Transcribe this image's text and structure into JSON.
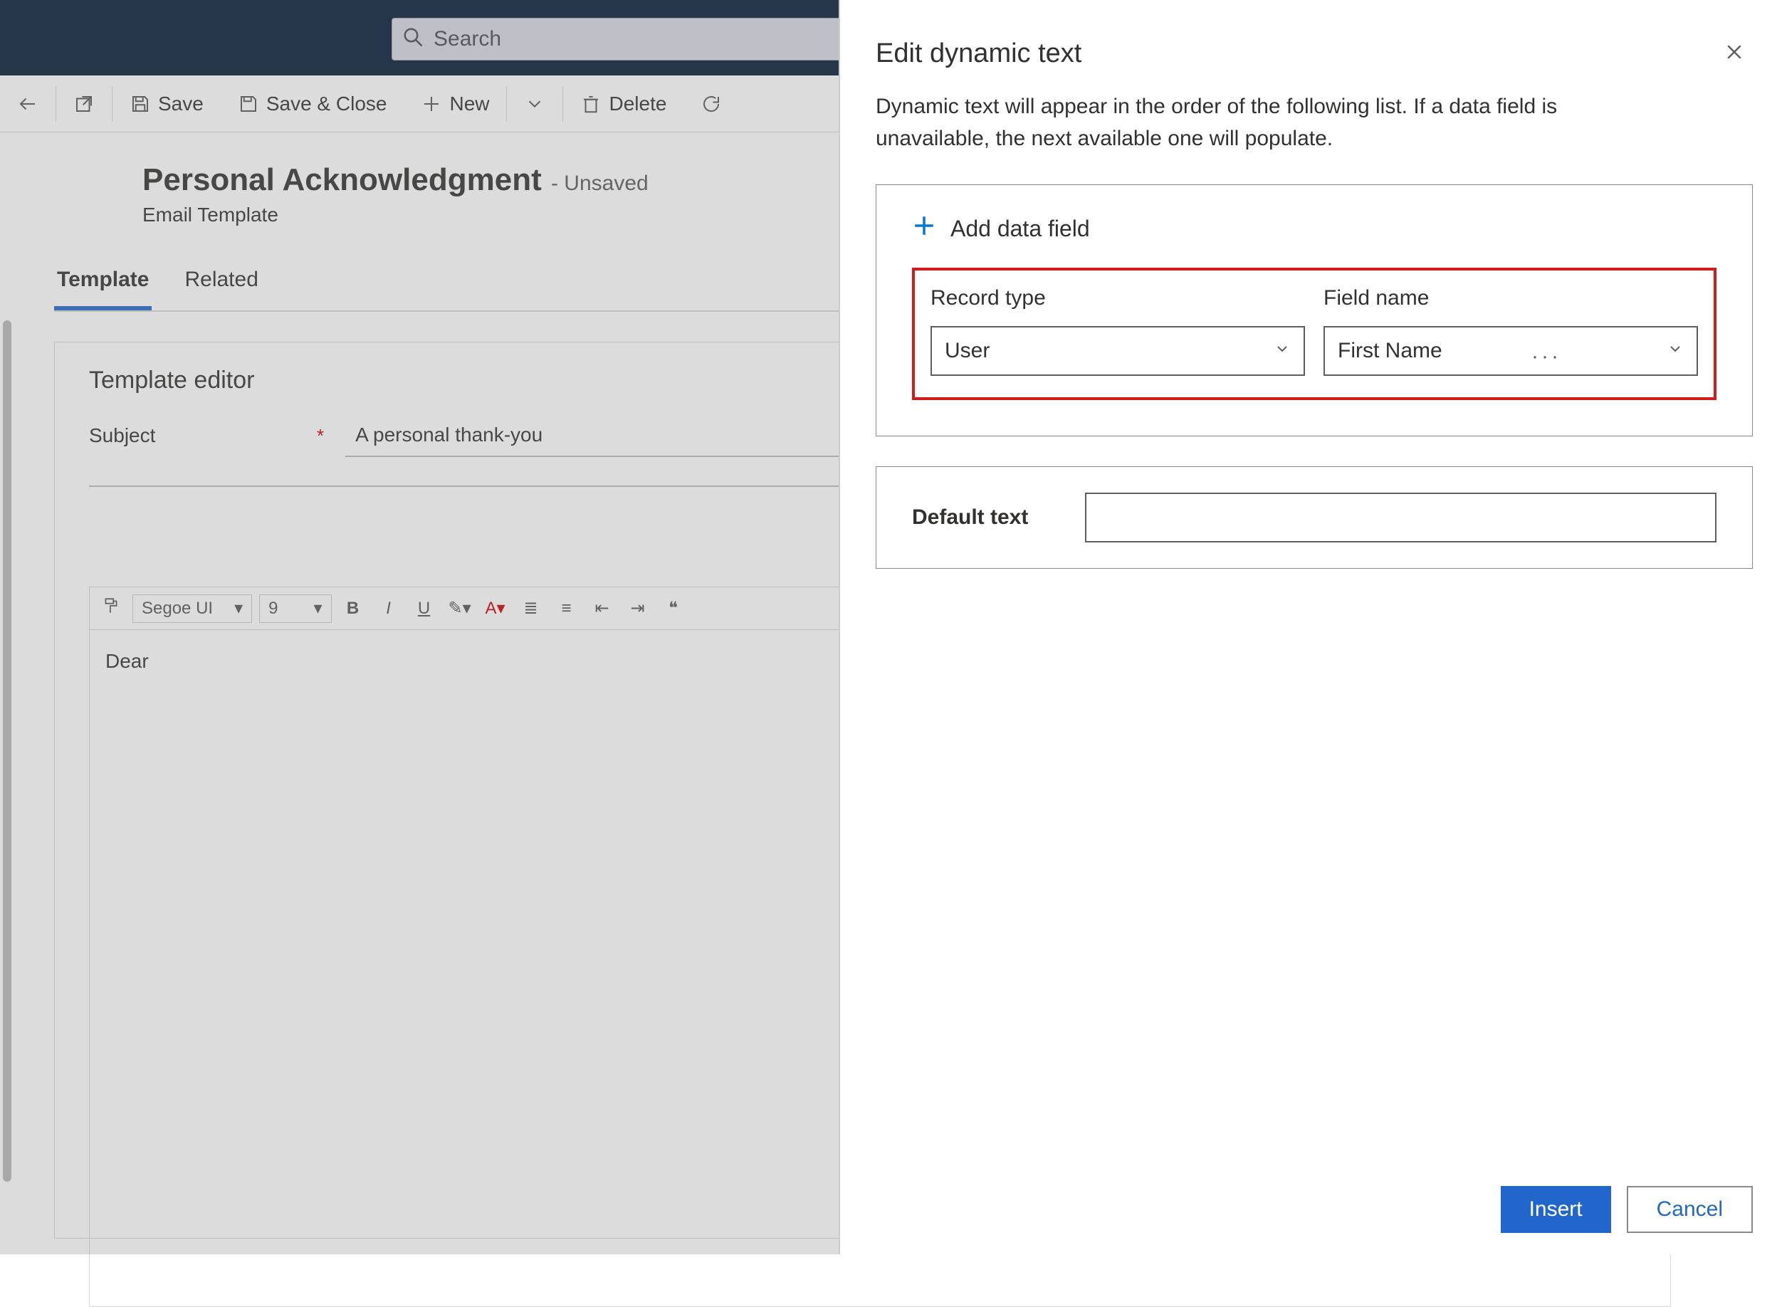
{
  "search": {
    "placeholder": "Search"
  },
  "commands": {
    "save": "Save",
    "save_close": "Save & Close",
    "new": "New",
    "delete": "Delete"
  },
  "page": {
    "title": "Personal Acknowledgment",
    "status": "- Unsaved",
    "subtitle": "Email Template"
  },
  "tabs": {
    "template": "Template",
    "related": "Related"
  },
  "editor": {
    "heading": "Template editor",
    "subject_label": "Subject",
    "subject_value": "A personal thank-you",
    "font_name": "Segoe UI",
    "font_size": "9",
    "body": "Dear"
  },
  "panel": {
    "title": "Edit dynamic text",
    "description": "Dynamic text will appear in the order of the following list. If a data field is unavailable, the next available one will populate.",
    "add_label": "Add data field",
    "record_type_label": "Record type",
    "field_name_label": "Field name",
    "record_type_value": "User",
    "field_name_value": "First Name",
    "default_text_label": "Default text",
    "default_text_value": "",
    "insert": "Insert",
    "cancel": "Cancel"
  }
}
